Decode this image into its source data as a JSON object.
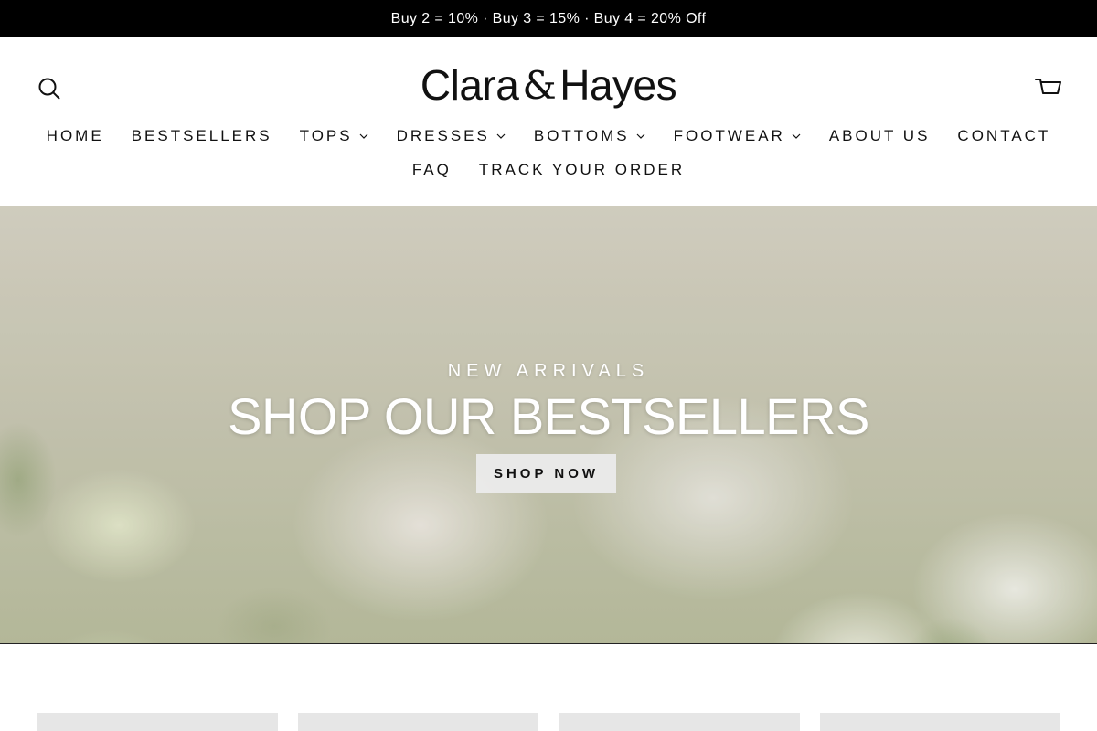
{
  "announcement": {
    "text": "Buy 2 = 10% · Buy 3 = 15% · Buy 4 = 20% Off"
  },
  "header": {
    "brand_left": "Clara",
    "brand_amp": "&",
    "brand_right": "Hayes",
    "search_icon": "search-icon",
    "cart_icon": "cart-icon"
  },
  "nav": {
    "row1": [
      {
        "label": "HOME",
        "dropdown": false
      },
      {
        "label": "BESTSELLERS",
        "dropdown": false
      },
      {
        "label": "TOPS",
        "dropdown": true
      },
      {
        "label": "DRESSES",
        "dropdown": true
      },
      {
        "label": "BOTTOMS",
        "dropdown": true
      },
      {
        "label": "FOOTWEAR",
        "dropdown": true
      },
      {
        "label": "ABOUT US",
        "dropdown": false
      },
      {
        "label": "CONTACT",
        "dropdown": false
      }
    ],
    "row2": [
      {
        "label": "FAQ",
        "dropdown": false
      },
      {
        "label": "TRACK YOUR ORDER",
        "dropdown": false
      }
    ]
  },
  "hero": {
    "eyebrow": "NEW ARRIVALS",
    "title": "SHOP OUR BESTSELLERS",
    "cta": "SHOP NOW"
  },
  "colors": {
    "announcement_bg": "#000000",
    "text": "#111111",
    "cta_bg": "#ebebeb",
    "card_placeholder": "#e6e6e6"
  }
}
